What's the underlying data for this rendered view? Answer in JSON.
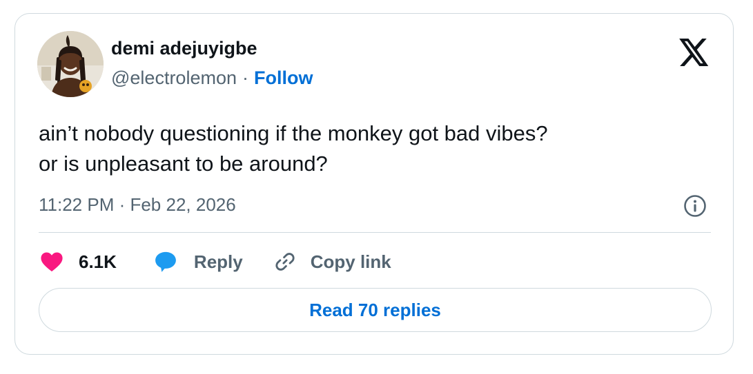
{
  "author": {
    "display_name": "demi adejuyigbe",
    "handle": "@electrolemon",
    "separator": "·",
    "follow_label": "Follow"
  },
  "tweet": {
    "text_line1": "ain’t nobody questioning if the monkey got bad vibes?",
    "text_line2": "or is unpleasant to be around?",
    "timestamp": "11:22 PM · Feb 22, 2026"
  },
  "actions": {
    "like_count": "6.1K",
    "reply_label": "Reply",
    "copy_link_label": "Copy link"
  },
  "footer": {
    "read_replies_label": "Read 70 replies"
  },
  "colors": {
    "like_heart": "#f91880",
    "reply_bubble": "#1d9bf0",
    "link_blue": "#006fd6",
    "muted_text": "#536471",
    "border": "#cfd9de"
  },
  "icons": [
    "x-logo-icon",
    "info-icon",
    "heart-icon",
    "reply-bubble-icon",
    "link-icon"
  ]
}
